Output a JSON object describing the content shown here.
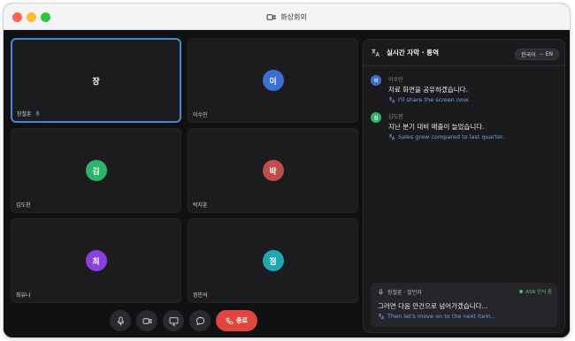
{
  "window": {
    "title": "화상회의",
    "title_icon": "video-camera-icon"
  },
  "participants": [
    {
      "initial": "장",
      "name": "장철훈",
      "color": "#1c1c1f",
      "active": true,
      "speaking_icon": "microphone-icon"
    },
    {
      "initial": "이",
      "name": "이수민",
      "color": "#3a6fd6",
      "active": false
    },
    {
      "initial": "김",
      "name": "김도현",
      "color": "#2fb36a",
      "active": false
    },
    {
      "initial": "박",
      "name": "박지훈",
      "color": "#c24b4b",
      "active": false
    },
    {
      "initial": "최",
      "name": "최유나",
      "color": "#8b3fe0",
      "active": false
    },
    {
      "initial": "정",
      "name": "정민석",
      "color": "#1ea7b5",
      "active": false
    }
  ],
  "controls": {
    "mic_icon": "microphone-icon",
    "camera_icon": "video-camera-icon",
    "screen_icon": "monitor-icon",
    "chat_icon": "chat-icon",
    "end_label": "종료",
    "end_icon": "phone-icon"
  },
  "panel": {
    "title": "실시간 자막 · 통역",
    "lang_from": "한국어",
    "lang_arrow": "→",
    "lang_to": "EN",
    "messages": [
      {
        "initial": "이",
        "color": "#3a6fd6",
        "speaker": "이수민",
        "original": "자료 화면을 공유하겠습니다.",
        "translation": "I'll share the screen now."
      },
      {
        "initial": "김",
        "color": "#2fb36a",
        "speaker": "김도현",
        "original": "지난 분기 대비 매출이 늘었습니다.",
        "translation": "Sales grew compared to last quarter."
      }
    ],
    "live": {
      "speaker_label": "장철훈 · 발언자",
      "status": "ASR 인식 중",
      "original": "그러면 다음 안건으로 넘어가겠습니다...",
      "translation": "Then let's move on to the next item..."
    }
  },
  "colors": {
    "accent": "#4a86d9",
    "danger": "#e0463e",
    "translation": "#6ea2ea",
    "asr": "#3fbf6b"
  }
}
